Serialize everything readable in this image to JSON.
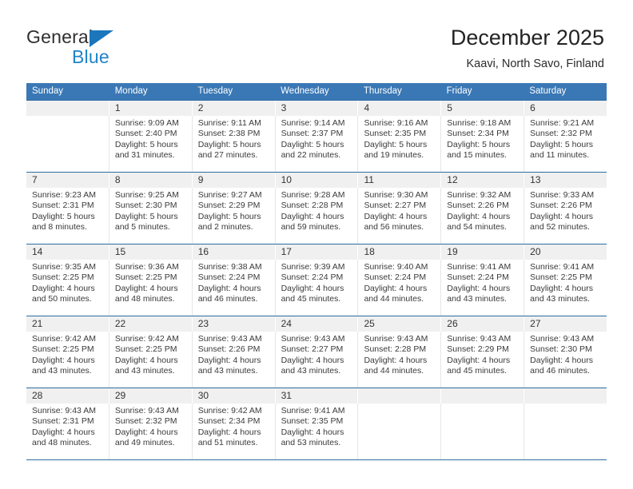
{
  "brand": {
    "name_top": "General",
    "name_bottom": "Blue",
    "triangle_icon": "triangle-icon",
    "accent_color": "#1b76bc"
  },
  "header": {
    "title": "December 2025",
    "subtitle": "Kaavi, North Savo, Finland"
  },
  "theme": {
    "header_row_bg": "#3a78b5",
    "header_row_text": "#ffffff",
    "week_divider": "#2e6da4",
    "date_band_bg": "#f0f0f0"
  },
  "weekdays": [
    "Sunday",
    "Monday",
    "Tuesday",
    "Wednesday",
    "Thursday",
    "Friday",
    "Saturday"
  ],
  "weeks": [
    [
      {
        "day": "",
        "l1": "",
        "l2": "",
        "l3": "",
        "l4": ""
      },
      {
        "day": "1",
        "l1": "Sunrise: 9:09 AM",
        "l2": "Sunset: 2:40 PM",
        "l3": "Daylight: 5 hours",
        "l4": "and 31 minutes."
      },
      {
        "day": "2",
        "l1": "Sunrise: 9:11 AM",
        "l2": "Sunset: 2:38 PM",
        "l3": "Daylight: 5 hours",
        "l4": "and 27 minutes."
      },
      {
        "day": "3",
        "l1": "Sunrise: 9:14 AM",
        "l2": "Sunset: 2:37 PM",
        "l3": "Daylight: 5 hours",
        "l4": "and 22 minutes."
      },
      {
        "day": "4",
        "l1": "Sunrise: 9:16 AM",
        "l2": "Sunset: 2:35 PM",
        "l3": "Daylight: 5 hours",
        "l4": "and 19 minutes."
      },
      {
        "day": "5",
        "l1": "Sunrise: 9:18 AM",
        "l2": "Sunset: 2:34 PM",
        "l3": "Daylight: 5 hours",
        "l4": "and 15 minutes."
      },
      {
        "day": "6",
        "l1": "Sunrise: 9:21 AM",
        "l2": "Sunset: 2:32 PM",
        "l3": "Daylight: 5 hours",
        "l4": "and 11 minutes."
      }
    ],
    [
      {
        "day": "7",
        "l1": "Sunrise: 9:23 AM",
        "l2": "Sunset: 2:31 PM",
        "l3": "Daylight: 5 hours",
        "l4": "and 8 minutes."
      },
      {
        "day": "8",
        "l1": "Sunrise: 9:25 AM",
        "l2": "Sunset: 2:30 PM",
        "l3": "Daylight: 5 hours",
        "l4": "and 5 minutes."
      },
      {
        "day": "9",
        "l1": "Sunrise: 9:27 AM",
        "l2": "Sunset: 2:29 PM",
        "l3": "Daylight: 5 hours",
        "l4": "and 2 minutes."
      },
      {
        "day": "10",
        "l1": "Sunrise: 9:28 AM",
        "l2": "Sunset: 2:28 PM",
        "l3": "Daylight: 4 hours",
        "l4": "and 59 minutes."
      },
      {
        "day": "11",
        "l1": "Sunrise: 9:30 AM",
        "l2": "Sunset: 2:27 PM",
        "l3": "Daylight: 4 hours",
        "l4": "and 56 minutes."
      },
      {
        "day": "12",
        "l1": "Sunrise: 9:32 AM",
        "l2": "Sunset: 2:26 PM",
        "l3": "Daylight: 4 hours",
        "l4": "and 54 minutes."
      },
      {
        "day": "13",
        "l1": "Sunrise: 9:33 AM",
        "l2": "Sunset: 2:26 PM",
        "l3": "Daylight: 4 hours",
        "l4": "and 52 minutes."
      }
    ],
    [
      {
        "day": "14",
        "l1": "Sunrise: 9:35 AM",
        "l2": "Sunset: 2:25 PM",
        "l3": "Daylight: 4 hours",
        "l4": "and 50 minutes."
      },
      {
        "day": "15",
        "l1": "Sunrise: 9:36 AM",
        "l2": "Sunset: 2:25 PM",
        "l3": "Daylight: 4 hours",
        "l4": "and 48 minutes."
      },
      {
        "day": "16",
        "l1": "Sunrise: 9:38 AM",
        "l2": "Sunset: 2:24 PM",
        "l3": "Daylight: 4 hours",
        "l4": "and 46 minutes."
      },
      {
        "day": "17",
        "l1": "Sunrise: 9:39 AM",
        "l2": "Sunset: 2:24 PM",
        "l3": "Daylight: 4 hours",
        "l4": "and 45 minutes."
      },
      {
        "day": "18",
        "l1": "Sunrise: 9:40 AM",
        "l2": "Sunset: 2:24 PM",
        "l3": "Daylight: 4 hours",
        "l4": "and 44 minutes."
      },
      {
        "day": "19",
        "l1": "Sunrise: 9:41 AM",
        "l2": "Sunset: 2:24 PM",
        "l3": "Daylight: 4 hours",
        "l4": "and 43 minutes."
      },
      {
        "day": "20",
        "l1": "Sunrise: 9:41 AM",
        "l2": "Sunset: 2:25 PM",
        "l3": "Daylight: 4 hours",
        "l4": "and 43 minutes."
      }
    ],
    [
      {
        "day": "21",
        "l1": "Sunrise: 9:42 AM",
        "l2": "Sunset: 2:25 PM",
        "l3": "Daylight: 4 hours",
        "l4": "and 43 minutes."
      },
      {
        "day": "22",
        "l1": "Sunrise: 9:42 AM",
        "l2": "Sunset: 2:25 PM",
        "l3": "Daylight: 4 hours",
        "l4": "and 43 minutes."
      },
      {
        "day": "23",
        "l1": "Sunrise: 9:43 AM",
        "l2": "Sunset: 2:26 PM",
        "l3": "Daylight: 4 hours",
        "l4": "and 43 minutes."
      },
      {
        "day": "24",
        "l1": "Sunrise: 9:43 AM",
        "l2": "Sunset: 2:27 PM",
        "l3": "Daylight: 4 hours",
        "l4": "and 43 minutes."
      },
      {
        "day": "25",
        "l1": "Sunrise: 9:43 AM",
        "l2": "Sunset: 2:28 PM",
        "l3": "Daylight: 4 hours",
        "l4": "and 44 minutes."
      },
      {
        "day": "26",
        "l1": "Sunrise: 9:43 AM",
        "l2": "Sunset: 2:29 PM",
        "l3": "Daylight: 4 hours",
        "l4": "and 45 minutes."
      },
      {
        "day": "27",
        "l1": "Sunrise: 9:43 AM",
        "l2": "Sunset: 2:30 PM",
        "l3": "Daylight: 4 hours",
        "l4": "and 46 minutes."
      }
    ],
    [
      {
        "day": "28",
        "l1": "Sunrise: 9:43 AM",
        "l2": "Sunset: 2:31 PM",
        "l3": "Daylight: 4 hours",
        "l4": "and 48 minutes."
      },
      {
        "day": "29",
        "l1": "Sunrise: 9:43 AM",
        "l2": "Sunset: 2:32 PM",
        "l3": "Daylight: 4 hours",
        "l4": "and 49 minutes."
      },
      {
        "day": "30",
        "l1": "Sunrise: 9:42 AM",
        "l2": "Sunset: 2:34 PM",
        "l3": "Daylight: 4 hours",
        "l4": "and 51 minutes."
      },
      {
        "day": "31",
        "l1": "Sunrise: 9:41 AM",
        "l2": "Sunset: 2:35 PM",
        "l3": "Daylight: 4 hours",
        "l4": "and 53 minutes."
      },
      {
        "day": "",
        "l1": "",
        "l2": "",
        "l3": "",
        "l4": ""
      },
      {
        "day": "",
        "l1": "",
        "l2": "",
        "l3": "",
        "l4": ""
      },
      {
        "day": "",
        "l1": "",
        "l2": "",
        "l3": "",
        "l4": ""
      }
    ]
  ]
}
